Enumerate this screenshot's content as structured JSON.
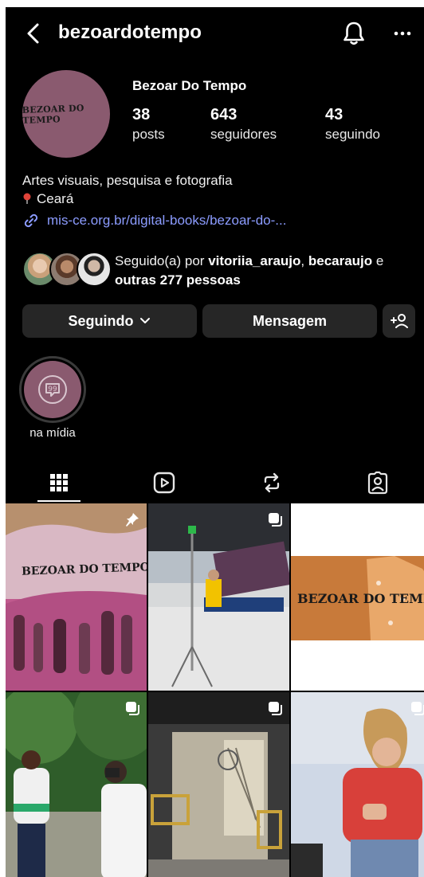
{
  "header": {
    "username": "bezoardotempo",
    "back_icon": "chevron-left-icon",
    "notifications_icon": "bell-icon",
    "more_icon": "more-horizontal-icon"
  },
  "profile": {
    "display_name": "Bezoar Do Tempo",
    "avatar_text": "BEZOAR DO TEMPO",
    "stats": [
      {
        "value": "38",
        "label": "posts"
      },
      {
        "value": "643",
        "label": "seguidores"
      },
      {
        "value": "43",
        "label": "seguindo"
      }
    ],
    "bio_line": "Artes visuais, pesquisa e fotografia",
    "location": "Ceará",
    "link": "mis-ce.org.br/digital-books/bezoar-do-..."
  },
  "followed_by": {
    "prefix": "Seguido(a) por ",
    "user1": "vitoriia_araujo",
    "sep": ", ",
    "user2": "becaraujo",
    "conj": " e",
    "others": "outras 277 pessoas"
  },
  "actions": {
    "following_label": "Seguindo",
    "message_label": "Mensagem",
    "add_person_icon": "add-person-icon"
  },
  "highlight": {
    "label": "na mídia"
  },
  "tabs": [
    {
      "icon": "grid-icon",
      "selected": true
    },
    {
      "icon": "reels-icon",
      "selected": false
    },
    {
      "icon": "reposts-icon",
      "selected": false
    },
    {
      "icon": "tagged-icon",
      "selected": false
    }
  ],
  "posts": [
    {
      "overlay": "BEZOAR DO TEMPO",
      "badge": "pinned-icon"
    },
    {
      "overlay": "",
      "badge": "carousel-icon"
    },
    {
      "overlay": "BEZOAR DO TEMPO",
      "badge": "carousel-icon"
    },
    {
      "overlay": "",
      "badge": "carousel-icon"
    },
    {
      "overlay": "",
      "badge": "carousel-icon"
    },
    {
      "overlay": "",
      "badge": "carousel-icon"
    }
  ],
  "colors": {
    "background": "#000000",
    "button": "#262626",
    "link": "#8c9cff",
    "brand": "#8a5a6f"
  }
}
